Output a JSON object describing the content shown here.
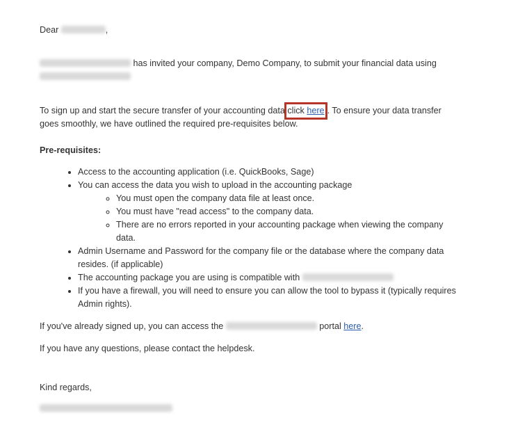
{
  "greeting": {
    "salutation": "Dear",
    "comma": ","
  },
  "intro": {
    "text": "has invited your company, Demo Company, to submit your financial data using"
  },
  "signup": {
    "text_before": "To sign up and start the secure transfer of your accounting data",
    "click_prefix": "click",
    "link_label": "here",
    "text_after": ". To ensure your data transfer goes smoothly, we have outlined the required pre-requisites below."
  },
  "prerequisites": {
    "heading": "Pre-requisites:",
    "item1": "Access to the accounting application (i.e. QuickBooks, Sage)",
    "item2": "You can access the data you wish to upload in the accounting package",
    "sub1": "You must open the company data file at least once.",
    "sub2": "You must have \"read access\" to the company data.",
    "sub3": "There are no errors reported in your accounting package when viewing the company data.",
    "item3": "Admin Username and Password for the company file or the database where the company data resides. (if applicable)",
    "item4": "The accounting package you are using is compatible with",
    "item5": "If you have a firewall, you will need to ensure you can allow the tool to bypass it (typically requires Admin rights)."
  },
  "portal": {
    "text_before": "If you've already signed up, you can access the",
    "text_middle": "portal",
    "link_label": "here",
    "period": "."
  },
  "questions": {
    "text": "If you have any questions, please contact the helpdesk."
  },
  "closing": {
    "text": "Kind regards,"
  },
  "colors": {
    "link": "#2a5db0",
    "highlight_border": "#b5352a",
    "text": "#333333"
  }
}
